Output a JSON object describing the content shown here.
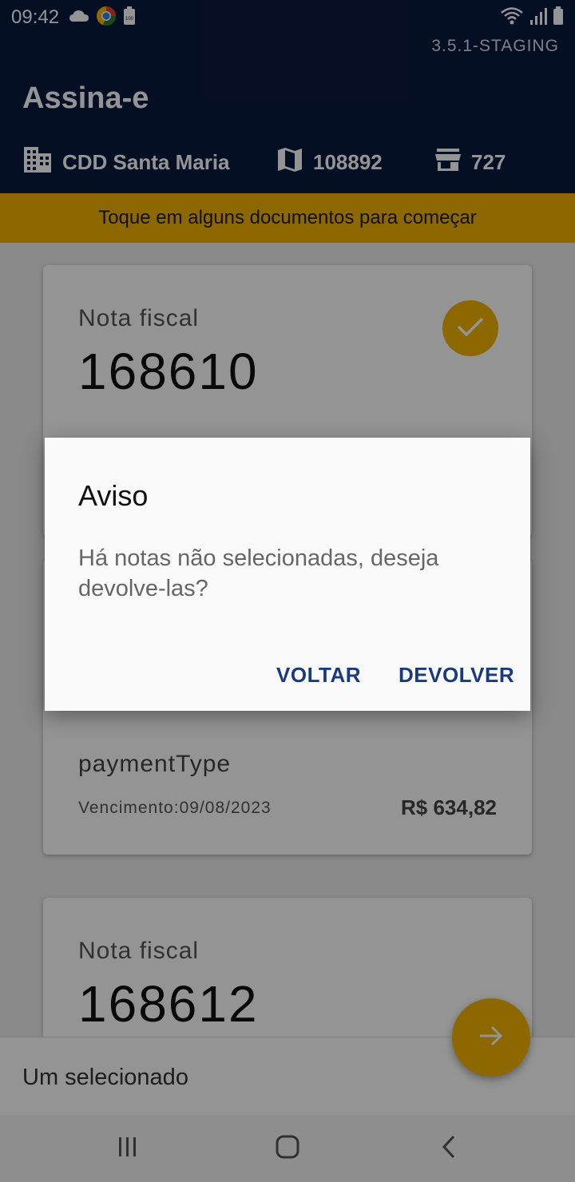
{
  "status_bar": {
    "time": "09:42",
    "battery_label": "100"
  },
  "header": {
    "version": "3.5.1-STAGING",
    "title": "Assina-e",
    "info": {
      "location": "CDD Santa Maria",
      "route": "108892",
      "store": "727"
    }
  },
  "banner": {
    "text": "Toque em alguns documentos para começar"
  },
  "cards": [
    {
      "label": "Nota fiscal",
      "number": "168610",
      "selected": true
    },
    {
      "payment_type": "paymentType",
      "due": "Vencimento:09/08/2023",
      "amount": "R$ 634,82"
    },
    {
      "label": "Nota fiscal",
      "number": "168612"
    }
  ],
  "bottom_bar": {
    "selection": "Um selecionado"
  },
  "dialog": {
    "title": "Aviso",
    "message": "Há notas não selecionadas, deseja devolve-las?",
    "cancel_label": "VOLTAR",
    "confirm_label": "DEVOLVER"
  },
  "colors": {
    "header_bg": "#0a1a3f",
    "accent": "#f3b400",
    "dialog_button": "#1a3a80"
  },
  "icons": {
    "weather": "cloud-icon",
    "app": "chrome-like-icon",
    "battery": "battery-icon",
    "wifi": "wifi-icon",
    "signal": "signal-icon",
    "location": "building-icon",
    "route": "map-icon",
    "store": "store-icon",
    "check": "check-icon",
    "fab": "arrow-right-icon"
  }
}
